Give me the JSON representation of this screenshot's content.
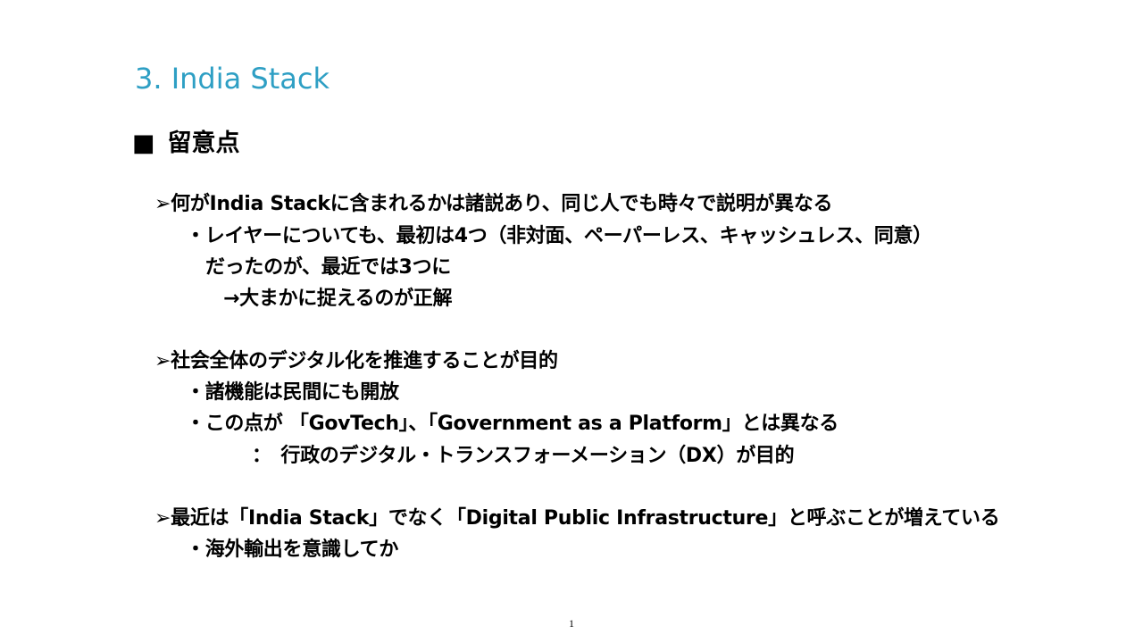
{
  "slide": {
    "title": "3. India Stack",
    "heading_marker": "■",
    "heading": "留意点",
    "arrow_marker": "➢",
    "bullet_marker": "・",
    "lines": {
      "l1": "何がIndia Stackに含まれるかは諸説あり、同じ人でも時々で説明が異なる",
      "l2": "レイヤーについても、最初は4つ（非対面、ペーパーレス、キャッシュレス、同意）",
      "l3": "だったのが、最近では3つに",
      "l4": "→大まかに捉えるのが正解",
      "l5": "社会全体のデジタル化を推進することが目的",
      "l6": "諸機能は民間にも開放",
      "l7": "この点が 「GovTech」、「Government as a Platform」とは異なる",
      "l8": "：　行政のデジタル・トランスフォーメーション（DX）が目的",
      "l9": "最近は「India Stack」でなく「Digital Public Infrastructure」と呼ぶことが増えている",
      "l10": "海外輸出を意識してか"
    },
    "page_number": "1",
    "colors": {
      "title": "#2e9fc4",
      "text": "#000000",
      "background": "#ffffff"
    }
  }
}
